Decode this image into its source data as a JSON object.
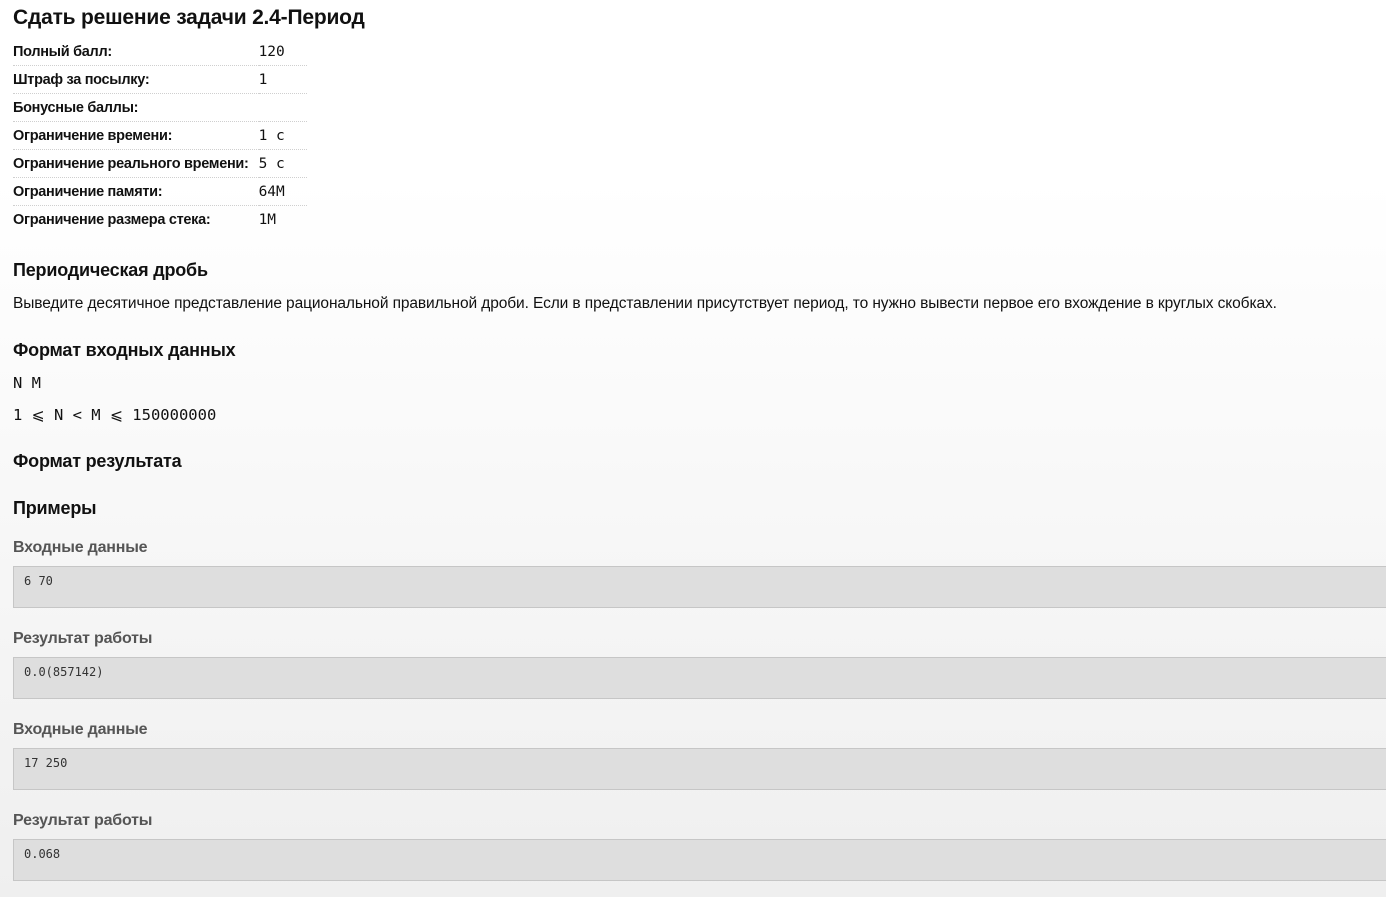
{
  "title": "Сдать решение задачи 2.4-Период",
  "props": [
    {
      "label": "Полный балл:",
      "value": "120"
    },
    {
      "label": "Штраф за посылку:",
      "value": "1"
    },
    {
      "label": "Бонусные баллы:",
      "value": ""
    },
    {
      "label": "Ограничение времени:",
      "value": "1 с"
    },
    {
      "label": "Ограничение реального времени:",
      "value": "5 с"
    },
    {
      "label": "Ограничение памяти:",
      "value": "64M"
    },
    {
      "label": "Ограничение размера стека:",
      "value": "1M"
    }
  ],
  "problem": {
    "heading": "Периодическая дробь",
    "statement": "Выведите десятичное представление рациональной правильной дроби. Если в представлении присутствует период, то нужно вывести первое его вхождение в круглых скобках."
  },
  "input_format": {
    "heading": "Формат входных данных",
    "line1": "N M",
    "line2": "1 ⩽ N < M ⩽ 150000000"
  },
  "output_format": {
    "heading": "Формат результата"
  },
  "examples": {
    "heading": "Примеры",
    "items": [
      {
        "input_label": "Входные данные",
        "input": "6 70",
        "output_label": "Результат работы",
        "output": "0.0(857142)"
      },
      {
        "input_label": "Входные данные",
        "input": "17 250",
        "output_label": "Результат работы",
        "output": "0.068"
      }
    ]
  }
}
